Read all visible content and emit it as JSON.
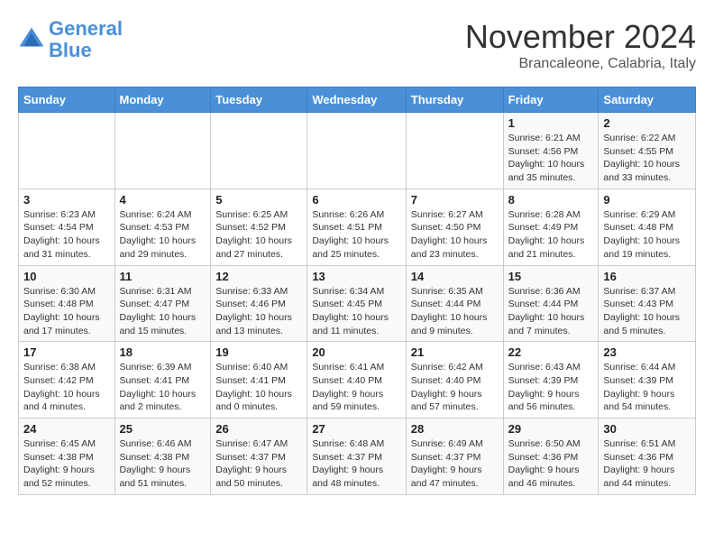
{
  "logo": {
    "line1": "General",
    "line2": "Blue"
  },
  "title": "November 2024",
  "subtitle": "Brancaleone, Calabria, Italy",
  "days_of_week": [
    "Sunday",
    "Monday",
    "Tuesday",
    "Wednesday",
    "Thursday",
    "Friday",
    "Saturday"
  ],
  "weeks": [
    [
      {
        "day": "",
        "info": ""
      },
      {
        "day": "",
        "info": ""
      },
      {
        "day": "",
        "info": ""
      },
      {
        "day": "",
        "info": ""
      },
      {
        "day": "",
        "info": ""
      },
      {
        "day": "1",
        "info": "Sunrise: 6:21 AM\nSunset: 4:56 PM\nDaylight: 10 hours\nand 35 minutes."
      },
      {
        "day": "2",
        "info": "Sunrise: 6:22 AM\nSunset: 4:55 PM\nDaylight: 10 hours\nand 33 minutes."
      }
    ],
    [
      {
        "day": "3",
        "info": "Sunrise: 6:23 AM\nSunset: 4:54 PM\nDaylight: 10 hours\nand 31 minutes."
      },
      {
        "day": "4",
        "info": "Sunrise: 6:24 AM\nSunset: 4:53 PM\nDaylight: 10 hours\nand 29 minutes."
      },
      {
        "day": "5",
        "info": "Sunrise: 6:25 AM\nSunset: 4:52 PM\nDaylight: 10 hours\nand 27 minutes."
      },
      {
        "day": "6",
        "info": "Sunrise: 6:26 AM\nSunset: 4:51 PM\nDaylight: 10 hours\nand 25 minutes."
      },
      {
        "day": "7",
        "info": "Sunrise: 6:27 AM\nSunset: 4:50 PM\nDaylight: 10 hours\nand 23 minutes."
      },
      {
        "day": "8",
        "info": "Sunrise: 6:28 AM\nSunset: 4:49 PM\nDaylight: 10 hours\nand 21 minutes."
      },
      {
        "day": "9",
        "info": "Sunrise: 6:29 AM\nSunset: 4:48 PM\nDaylight: 10 hours\nand 19 minutes."
      }
    ],
    [
      {
        "day": "10",
        "info": "Sunrise: 6:30 AM\nSunset: 4:48 PM\nDaylight: 10 hours\nand 17 minutes."
      },
      {
        "day": "11",
        "info": "Sunrise: 6:31 AM\nSunset: 4:47 PM\nDaylight: 10 hours\nand 15 minutes."
      },
      {
        "day": "12",
        "info": "Sunrise: 6:33 AM\nSunset: 4:46 PM\nDaylight: 10 hours\nand 13 minutes."
      },
      {
        "day": "13",
        "info": "Sunrise: 6:34 AM\nSunset: 4:45 PM\nDaylight: 10 hours\nand 11 minutes."
      },
      {
        "day": "14",
        "info": "Sunrise: 6:35 AM\nSunset: 4:44 PM\nDaylight: 10 hours\nand 9 minutes."
      },
      {
        "day": "15",
        "info": "Sunrise: 6:36 AM\nSunset: 4:44 PM\nDaylight: 10 hours\nand 7 minutes."
      },
      {
        "day": "16",
        "info": "Sunrise: 6:37 AM\nSunset: 4:43 PM\nDaylight: 10 hours\nand 5 minutes."
      }
    ],
    [
      {
        "day": "17",
        "info": "Sunrise: 6:38 AM\nSunset: 4:42 PM\nDaylight: 10 hours\nand 4 minutes."
      },
      {
        "day": "18",
        "info": "Sunrise: 6:39 AM\nSunset: 4:41 PM\nDaylight: 10 hours\nand 2 minutes."
      },
      {
        "day": "19",
        "info": "Sunrise: 6:40 AM\nSunset: 4:41 PM\nDaylight: 10 hours\nand 0 minutes."
      },
      {
        "day": "20",
        "info": "Sunrise: 6:41 AM\nSunset: 4:40 PM\nDaylight: 9 hours\nand 59 minutes."
      },
      {
        "day": "21",
        "info": "Sunrise: 6:42 AM\nSunset: 4:40 PM\nDaylight: 9 hours\nand 57 minutes."
      },
      {
        "day": "22",
        "info": "Sunrise: 6:43 AM\nSunset: 4:39 PM\nDaylight: 9 hours\nand 56 minutes."
      },
      {
        "day": "23",
        "info": "Sunrise: 6:44 AM\nSunset: 4:39 PM\nDaylight: 9 hours\nand 54 minutes."
      }
    ],
    [
      {
        "day": "24",
        "info": "Sunrise: 6:45 AM\nSunset: 4:38 PM\nDaylight: 9 hours\nand 52 minutes."
      },
      {
        "day": "25",
        "info": "Sunrise: 6:46 AM\nSunset: 4:38 PM\nDaylight: 9 hours\nand 51 minutes."
      },
      {
        "day": "26",
        "info": "Sunrise: 6:47 AM\nSunset: 4:37 PM\nDaylight: 9 hours\nand 50 minutes."
      },
      {
        "day": "27",
        "info": "Sunrise: 6:48 AM\nSunset: 4:37 PM\nDaylight: 9 hours\nand 48 minutes."
      },
      {
        "day": "28",
        "info": "Sunrise: 6:49 AM\nSunset: 4:37 PM\nDaylight: 9 hours\nand 47 minutes."
      },
      {
        "day": "29",
        "info": "Sunrise: 6:50 AM\nSunset: 4:36 PM\nDaylight: 9 hours\nand 46 minutes."
      },
      {
        "day": "30",
        "info": "Sunrise: 6:51 AM\nSunset: 4:36 PM\nDaylight: 9 hours\nand 44 minutes."
      }
    ]
  ]
}
